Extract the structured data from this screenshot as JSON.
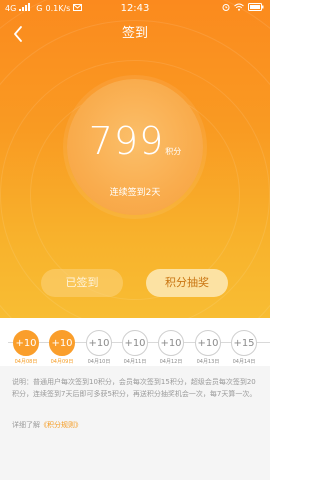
{
  "status_bar": {
    "network": "4G",
    "signal_label": "G",
    "speed": "0.1K/s",
    "time": "12:43"
  },
  "nav": {
    "title": "签到"
  },
  "points_card": {
    "points": "799",
    "unit": "积分",
    "streak_text": "连续签到2天"
  },
  "buttons": {
    "signed_label": "已签到",
    "lottery_label": "积分抽奖"
  },
  "calendar": [
    {
      "reward": "+10",
      "date": "04月08日",
      "signed": true
    },
    {
      "reward": "+10",
      "date": "04月09日",
      "signed": true
    },
    {
      "reward": "+10",
      "date": "04月10日",
      "signed": false
    },
    {
      "reward": "+10",
      "date": "04月11日",
      "signed": false
    },
    {
      "reward": "+10",
      "date": "04月12日",
      "signed": false
    },
    {
      "reward": "+10",
      "date": "04月13日",
      "signed": false
    },
    {
      "reward": "+15",
      "date": "04月14日",
      "signed": false
    }
  ],
  "info": {
    "rules_text": "说明：普通用户每次签到10积分，会员每次签到15积分，超级会员每次签到20积分，连续签到7天后即可多获5积分，再送积分抽奖机会一次，每7天算一次。",
    "more_prefix": "详细了解",
    "more_link": "《积分规则》"
  },
  "colors": {
    "header_top": "#fb8a1e",
    "header_bottom": "#f8bd33",
    "accent": "#fa9e2b"
  }
}
